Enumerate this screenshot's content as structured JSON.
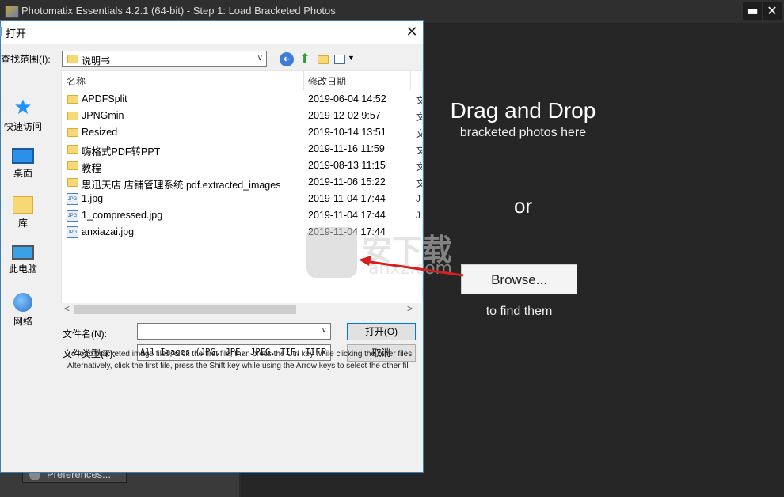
{
  "app": {
    "title": "Photomatix Essentials  4.2.1 (64-bit) - Step 1: Load Bracketed Photos",
    "minimize": "▬",
    "close": "✕",
    "preferences": "Preferences..."
  },
  "dropzone": {
    "title": "Drag and Drop",
    "subtitle": "bracketed photos here",
    "or": "or",
    "browse": "Browse...",
    "find": "to find them"
  },
  "dialog": {
    "title": "打开",
    "close": "✕",
    "lookin_label": "查找范围(I):",
    "lookin_value": "说明书",
    "places": [
      "快速访问",
      "桌面",
      "库",
      "此电脑",
      "网络"
    ],
    "columns": {
      "name": "名称",
      "date": "修改日期"
    },
    "files": [
      {
        "name": "APDFSplit",
        "date": "2019-06-04 14:52",
        "type": "folder",
        "more": "文"
      },
      {
        "name": "JPNGmin",
        "date": "2019-12-02 9:57",
        "type": "folder",
        "more": "文"
      },
      {
        "name": "Resized",
        "date": "2019-10-14 13:51",
        "type": "folder",
        "more": "文"
      },
      {
        "name": "嗨格式PDF转PPT",
        "date": "2019-11-16 11:59",
        "type": "folder",
        "more": "文"
      },
      {
        "name": "教程",
        "date": "2019-08-13 11:15",
        "type": "folder",
        "more": "文"
      },
      {
        "name": "思迅天店 店铺管理系统.pdf.extracted_images",
        "date": "2019-11-06 15:22",
        "type": "folder",
        "more": "文"
      },
      {
        "name": "1.jpg",
        "date": "2019-11-04 17:44",
        "type": "jpg",
        "more": "J"
      },
      {
        "name": "1_compressed.jpg",
        "date": "2019-11-04 17:44",
        "type": "jpg",
        "more": "J"
      },
      {
        "name": "anxiazai.jpg",
        "date": "2019-11-04 17:44",
        "type": "jpg",
        "more": ""
      }
    ],
    "filename_label": "文件名(N):",
    "filename_value": "",
    "filetype_label": "文件类型(T):",
    "filetype_value": "All Images (JPG, JPE, JPEG, TIF, TIFF",
    "open_button": "打开(O)",
    "cancel_button": "取消",
    "help_line1": "To load bracketed image files, click the first file, then press the Ctrl key while clicking the other files",
    "help_line2": "Alternatively, click the first file, press the Shift key while using the Arrow keys to select the other fil"
  },
  "watermark": {
    "text": "安下载",
    "domain": "anxz.com"
  },
  "icons": {
    "jpg_badge": "JPG",
    "back": "➜",
    "up": "⬆"
  }
}
